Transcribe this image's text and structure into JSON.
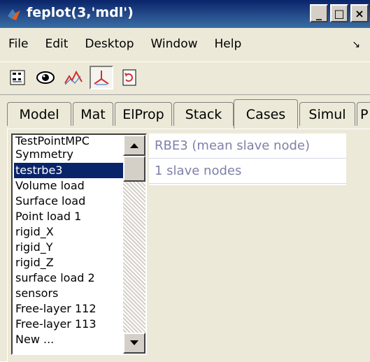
{
  "window": {
    "title": "feplot(3,'mdl')",
    "minimize_label": "_",
    "maximize_label": "□",
    "close_label": "×"
  },
  "menu": {
    "items": [
      {
        "label": "File"
      },
      {
        "label": "Edit"
      },
      {
        "label": "Desktop"
      },
      {
        "label": "Window"
      },
      {
        "label": "Help"
      }
    ],
    "overflow_label": "↘"
  },
  "toolbar": {
    "buttons": [
      "matrix-icon",
      "eye-icon",
      "mode-shape-icon",
      "triad-icon",
      "refresh-icon"
    ]
  },
  "tabs": [
    {
      "label": "Model"
    },
    {
      "label": "Mat"
    },
    {
      "label": "ElProp"
    },
    {
      "label": "Stack"
    },
    {
      "label": "Cases"
    },
    {
      "label": "Simul"
    },
    {
      "label": "P"
    }
  ],
  "cases_list": {
    "items": [
      "TestPointMPC",
      "Symmetry",
      "testrbe3",
      "Volume load",
      "Surface load",
      "Point load 1",
      "rigid_X",
      "rigid_Y",
      "rigid_Z",
      "surface load 2",
      "sensors",
      "Free-layer 112",
      "Free-layer 113",
      "New ..."
    ],
    "selected_index": 2
  },
  "properties": {
    "rows": [
      "RBE3 (mean slave node)",
      "1 slave nodes"
    ]
  },
  "colors": {
    "selection": "#0a246a",
    "title_start": "#0a246a",
    "title_end": "#3a6ea5",
    "property_text": "#8080a8"
  }
}
